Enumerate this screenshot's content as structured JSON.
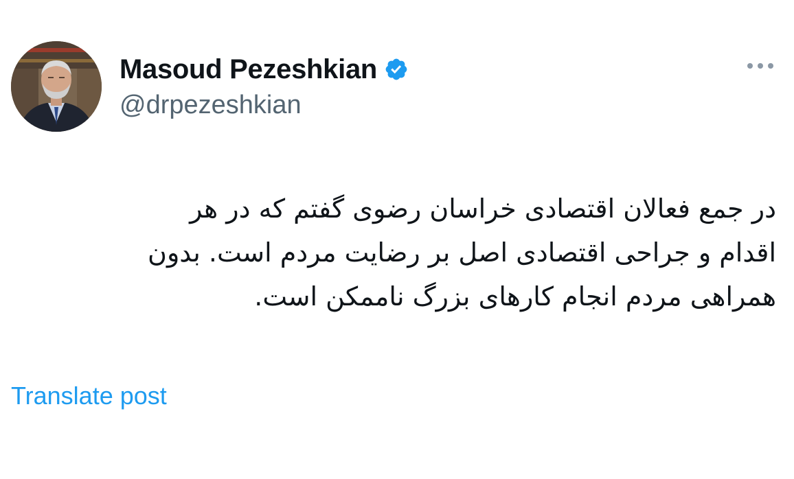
{
  "author": {
    "display_name": "Masoud Pezeshkian",
    "handle": "@drpezeshkian",
    "verified": true,
    "verified_badge_color": "#1d9bf0"
  },
  "header": {
    "more_icon": "more-horizontal-icon"
  },
  "tweet": {
    "lines": [
      "در جمع فعالان اقتصادی خراسان رضوی گفتم که در هر",
      "اقدام و جراحی اقتصادی اصل بر رضایت مردم است. بدون",
      "همراهی مردم انجام کارهای بزرگ ناممکن است."
    ]
  },
  "actions": {
    "translate_label": "Translate post"
  },
  "colors": {
    "link": "#1d9bf0",
    "secondary_text": "#536471",
    "primary_text": "#0f1419",
    "background": "#ffffff"
  }
}
